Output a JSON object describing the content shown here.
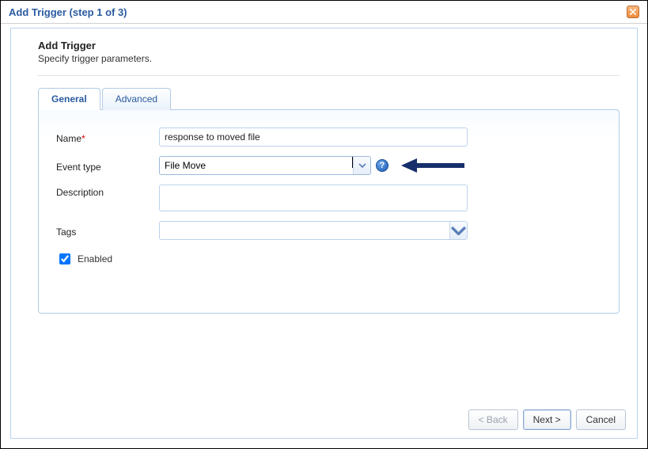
{
  "dialog": {
    "title": "Add Trigger (step 1 of 3)"
  },
  "header": {
    "title": "Add Trigger",
    "subtitle": "Specify trigger parameters."
  },
  "tabs": {
    "general": "General",
    "advanced": "Advanced",
    "active": "general"
  },
  "form": {
    "name_label": "Name",
    "name_value": "response to moved file",
    "event_label": "Event type",
    "event_value": "File Move",
    "description_label": "Description",
    "description_value": "",
    "tags_label": "Tags",
    "tags_value": "",
    "enabled_label": "Enabled",
    "enabled_checked": true
  },
  "icons": {
    "help": "?",
    "chevron_down": "chevron-down-icon",
    "close": "close-icon",
    "arrow": "arrow-left-icon"
  },
  "colors": {
    "accent": "#2a5aa0",
    "panel_border": "#b3cbe6",
    "arrow": "#172f6b"
  },
  "buttons": {
    "back": "< Back",
    "next": "Next >",
    "cancel": "Cancel"
  }
}
